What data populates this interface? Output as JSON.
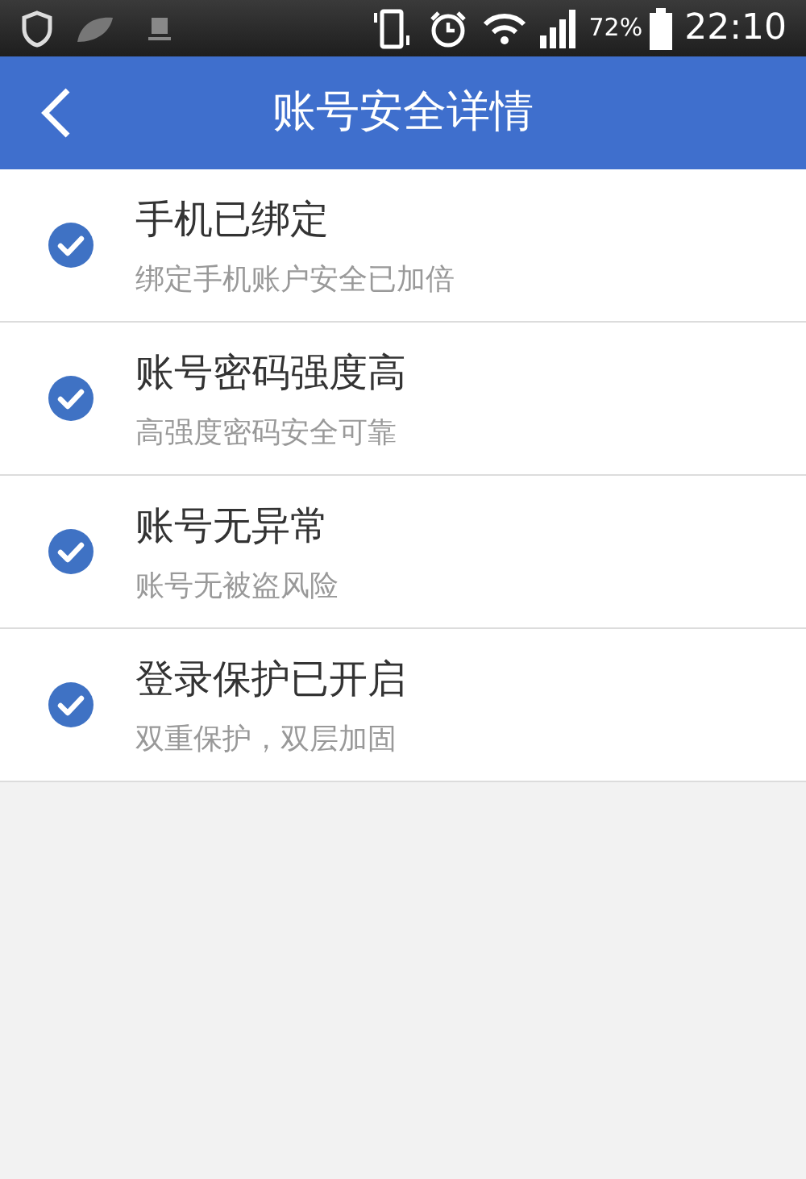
{
  "status_bar": {
    "battery": "72%",
    "time": "22:10"
  },
  "header": {
    "title": "账号安全详情"
  },
  "items": [
    {
      "title": "手机已绑定",
      "subtitle": "绑定手机账户安全已加倍",
      "checked": true
    },
    {
      "title": "账号密码强度高",
      "subtitle": "高强度密码安全可靠",
      "checked": true
    },
    {
      "title": "账号无异常",
      "subtitle": "账号无被盗风险",
      "checked": true
    },
    {
      "title": "登录保护已开启",
      "subtitle": "双重保护，双层加固",
      "checked": true
    }
  ]
}
